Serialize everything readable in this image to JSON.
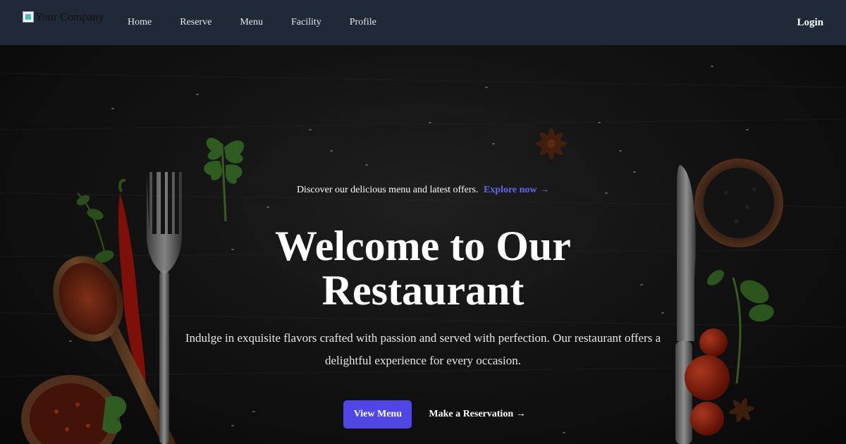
{
  "nav": {
    "logo_alt": "Your Company",
    "links": [
      "Home",
      "Reserve",
      "Menu",
      "Facility",
      "Profile"
    ],
    "login": "Login"
  },
  "hero": {
    "announcement": "Discover our delicious menu and latest offers.",
    "explore": "Explore now →",
    "title": "Welcome to Our Restaurant",
    "description": "Indulge in exquisite flavors crafted with passion and served with perfection. Our restaurant offers a delightful experience for every occasion.",
    "primary_button": "View Menu",
    "secondary_link": "Make a Reservation →"
  },
  "colors": {
    "navbar": "#1f2937",
    "accent": "#4f46e5",
    "accent_text": "#6366f1"
  }
}
